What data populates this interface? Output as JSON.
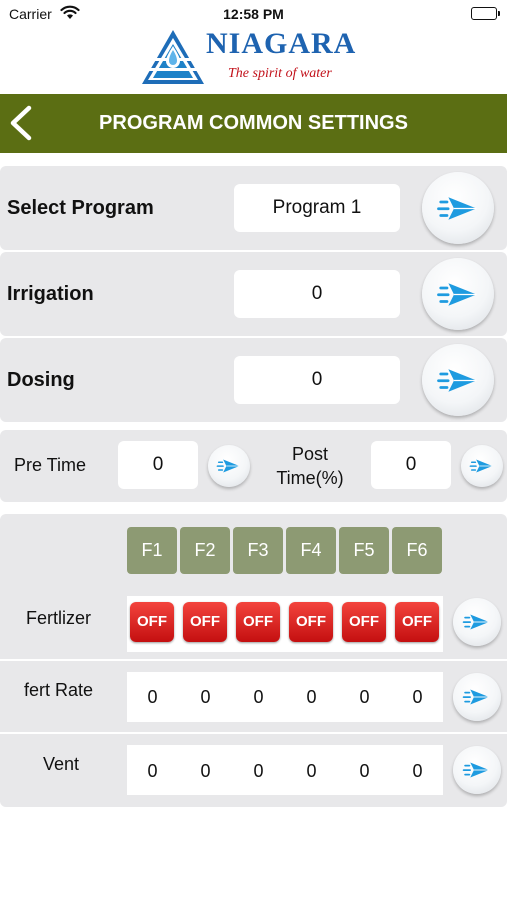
{
  "status_bar": {
    "carrier": "Carrier",
    "time": "12:58 PM"
  },
  "logo": {
    "brand": "NIAGARA",
    "tagline": "The spirit of water"
  },
  "header": {
    "title": "PROGRAM COMMON SETTINGS"
  },
  "select_program": {
    "label": "Select Program",
    "value": "Program 1"
  },
  "irrigation": {
    "label": "Irrigation",
    "value": "0"
  },
  "dosing": {
    "label": "Dosing",
    "value": "0"
  },
  "pre_time": {
    "label": "Pre Time",
    "value": "0"
  },
  "post_time": {
    "label": "Post Time(%)",
    "value": "0"
  },
  "fertilizer_grid": {
    "channels": [
      "F1",
      "F2",
      "F3",
      "F4",
      "F5",
      "F6"
    ],
    "fertilizer_label": "Fertlizer",
    "fertilizer_states": [
      "OFF",
      "OFF",
      "OFF",
      "OFF",
      "OFF",
      "OFF"
    ],
    "fert_rate_label": "fert Rate",
    "fert_rates": [
      "0",
      "0",
      "0",
      "0",
      "0",
      "0"
    ],
    "vent_label": "Vent",
    "vents": [
      "0",
      "0",
      "0",
      "0",
      "0",
      "0"
    ]
  },
  "colors": {
    "header_bg": "#5b6e13",
    "card_bg": "#e8e8ea",
    "channel_tag": "#8d9a73",
    "off_red": "#d81a1a",
    "send_blue": "#1e9be0",
    "brand_blue": "#1e63b0",
    "tagline_red": "#c2121b"
  },
  "icons": {
    "back": "chevron-left-icon",
    "send": "paper-plane-send-icon",
    "wifi": "wifi-icon",
    "battery": "battery-icon",
    "logo_mark": "water-drop-pyramid-icon"
  }
}
